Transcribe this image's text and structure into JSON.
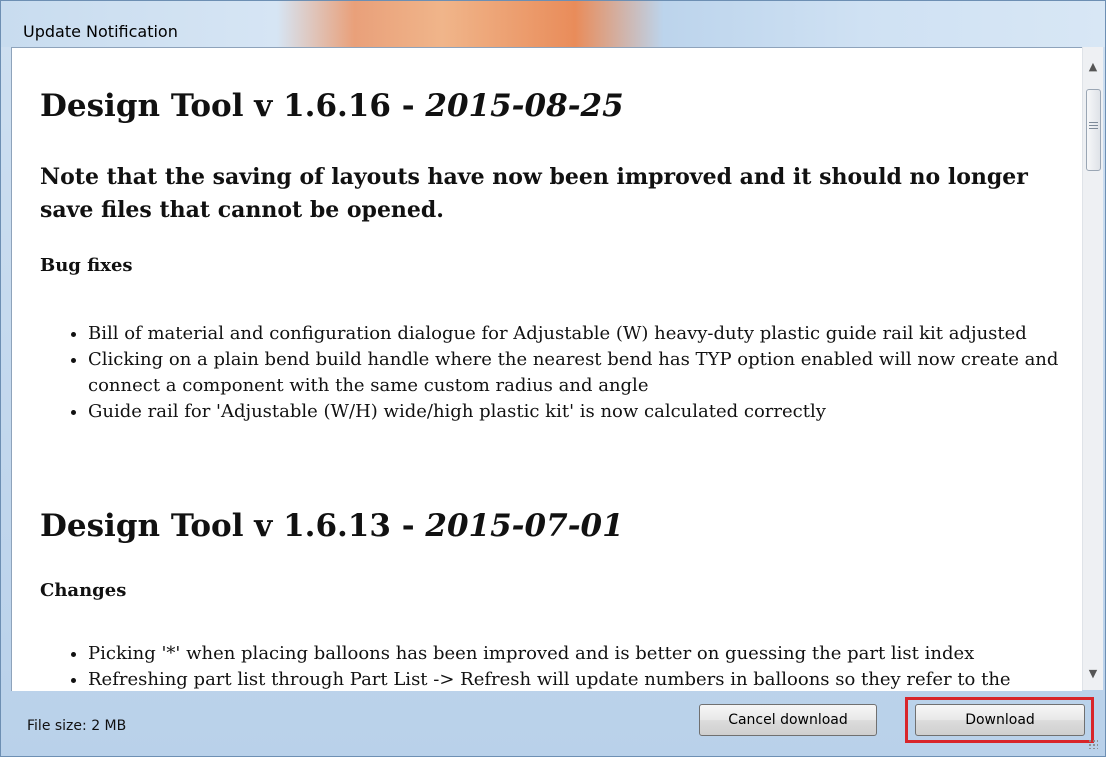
{
  "window": {
    "title": "Update Notification"
  },
  "releases": [
    {
      "heading": "Design Tool v 1.6.16 - ",
      "date": "2015-08-25",
      "note": "Note that the saving of layouts have now been improved and it should no longer save files that cannot be opened.",
      "section": "Bug fixes",
      "items": [
        "Bill of material and configuration dialogue for Adjustable (W) heavy-duty plastic guide rail kit adjusted",
        "Clicking on a plain bend build handle where the nearest bend has TYP option enabled will now create and connect a component with the same custom radius and angle",
        "Guide rail for 'Adjustable (W/H) wide/high plastic kit' is now calculated correctly"
      ]
    },
    {
      "heading": "Design Tool v 1.6.13 - ",
      "date": "2015-07-01",
      "section": "Changes",
      "items": [
        "Picking '*' when placing balloons has been improved and is better on guessing the part list index",
        "Refreshing part list through Part List -> Refresh will update numbers in balloons so they refer to the"
      ]
    }
  ],
  "footer": {
    "file_size": "File size: 2 MB",
    "cancel_label": "Cancel download",
    "download_label": "Download"
  },
  "colors": {
    "highlight": "#d8252a"
  },
  "icons": {
    "scroll_up": "arrow-up-icon",
    "scroll_down": "arrow-down-icon",
    "thumb_grip": "grip-icon"
  }
}
